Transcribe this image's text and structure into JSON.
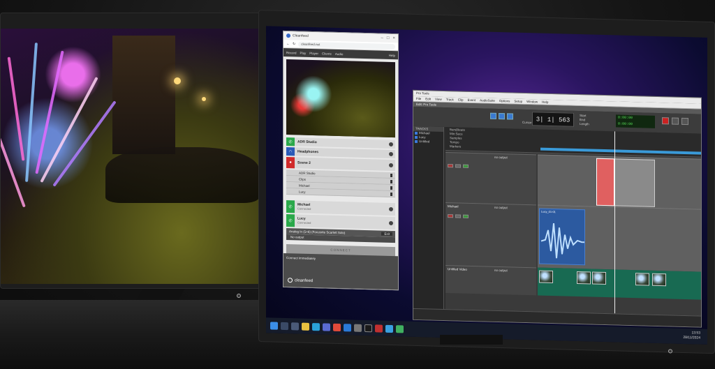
{
  "webapp": {
    "window_title": "Cleanfeed",
    "url": "cleanfeed.net",
    "toolbar": [
      "Record",
      "Play",
      "Player",
      "Clients",
      "Audio"
    ],
    "toolbar_right": "Help",
    "rows": [
      {
        "label": "ADR Studio",
        "sub": "",
        "color": "green"
      },
      {
        "label": "Headphones",
        "sub": "",
        "color": "blue"
      },
      {
        "label": "Scene 2",
        "sub": "",
        "color": "red"
      },
      {
        "label": "Michael",
        "sub": "Connected",
        "color": "green"
      },
      {
        "label": "Lucy",
        "sub": "Connected",
        "color": "green"
      }
    ],
    "scene_members": [
      "ADR Studio",
      "Clips",
      "Michael",
      "Lucy"
    ],
    "device_row": "Analog In (5+6) (Focusrite Scarlett Solo)",
    "exit_label": "Exit",
    "no_output": "No output",
    "connect_button": "CONNECT",
    "footer_status": "Connect immediately",
    "brand": "cleanfeed"
  },
  "daw": {
    "title": "Pro Tools",
    "menu": [
      "File",
      "Edit",
      "View",
      "Track",
      "Clip",
      "Event",
      "AudioSuite",
      "Options",
      "Setup",
      "Window",
      "Help"
    ],
    "edit_window_title": "Edit: Pro Tools",
    "counter": "3| 1| 563",
    "counter_label": "Cursor",
    "counter_side": [
      "Start",
      "End",
      "Length"
    ],
    "green_display": [
      "0:00:00",
      "0:00:00"
    ],
    "tracklist_header": "TRACKS",
    "tracklist": [
      "Michael",
      "Lucy",
      "Untitled"
    ],
    "ruler_labels": [
      "Bars|Beats",
      "Min:Secs",
      "Samples",
      "Tempo",
      "Markers"
    ],
    "tracks": [
      {
        "name": "",
        "sub": "",
        "io": "no output"
      },
      {
        "name": "Michael",
        "sub": "",
        "io": "no output"
      },
      {
        "name": "Untitled Video",
        "sub": "",
        "io": "no output"
      }
    ],
    "wave_region_label": "Lucy_01-01",
    "icon_names": [
      "grabber-tool-icon",
      "trim-tool-icon",
      "selector-tool-icon",
      "record-button-icon",
      "play-button-icon",
      "stop-button-icon"
    ]
  },
  "taskbar": {
    "time": "13:53",
    "date": "28/11/2024",
    "icons": [
      "windows-start-icon",
      "search-icon",
      "task-view-icon",
      "explorer-icon",
      "edge-icon",
      "store-icon",
      "chrome-icon",
      "mail-icon",
      "settings-icon",
      "protools-icon"
    ]
  },
  "colors": {
    "app_green": "#2aa84a",
    "app_red": "#d02a2a",
    "app_blue": "#2a5ab8",
    "daw_region": "#2c5aa0",
    "video_lane": "#186a52",
    "wallpaper": "#5a2a9a"
  }
}
